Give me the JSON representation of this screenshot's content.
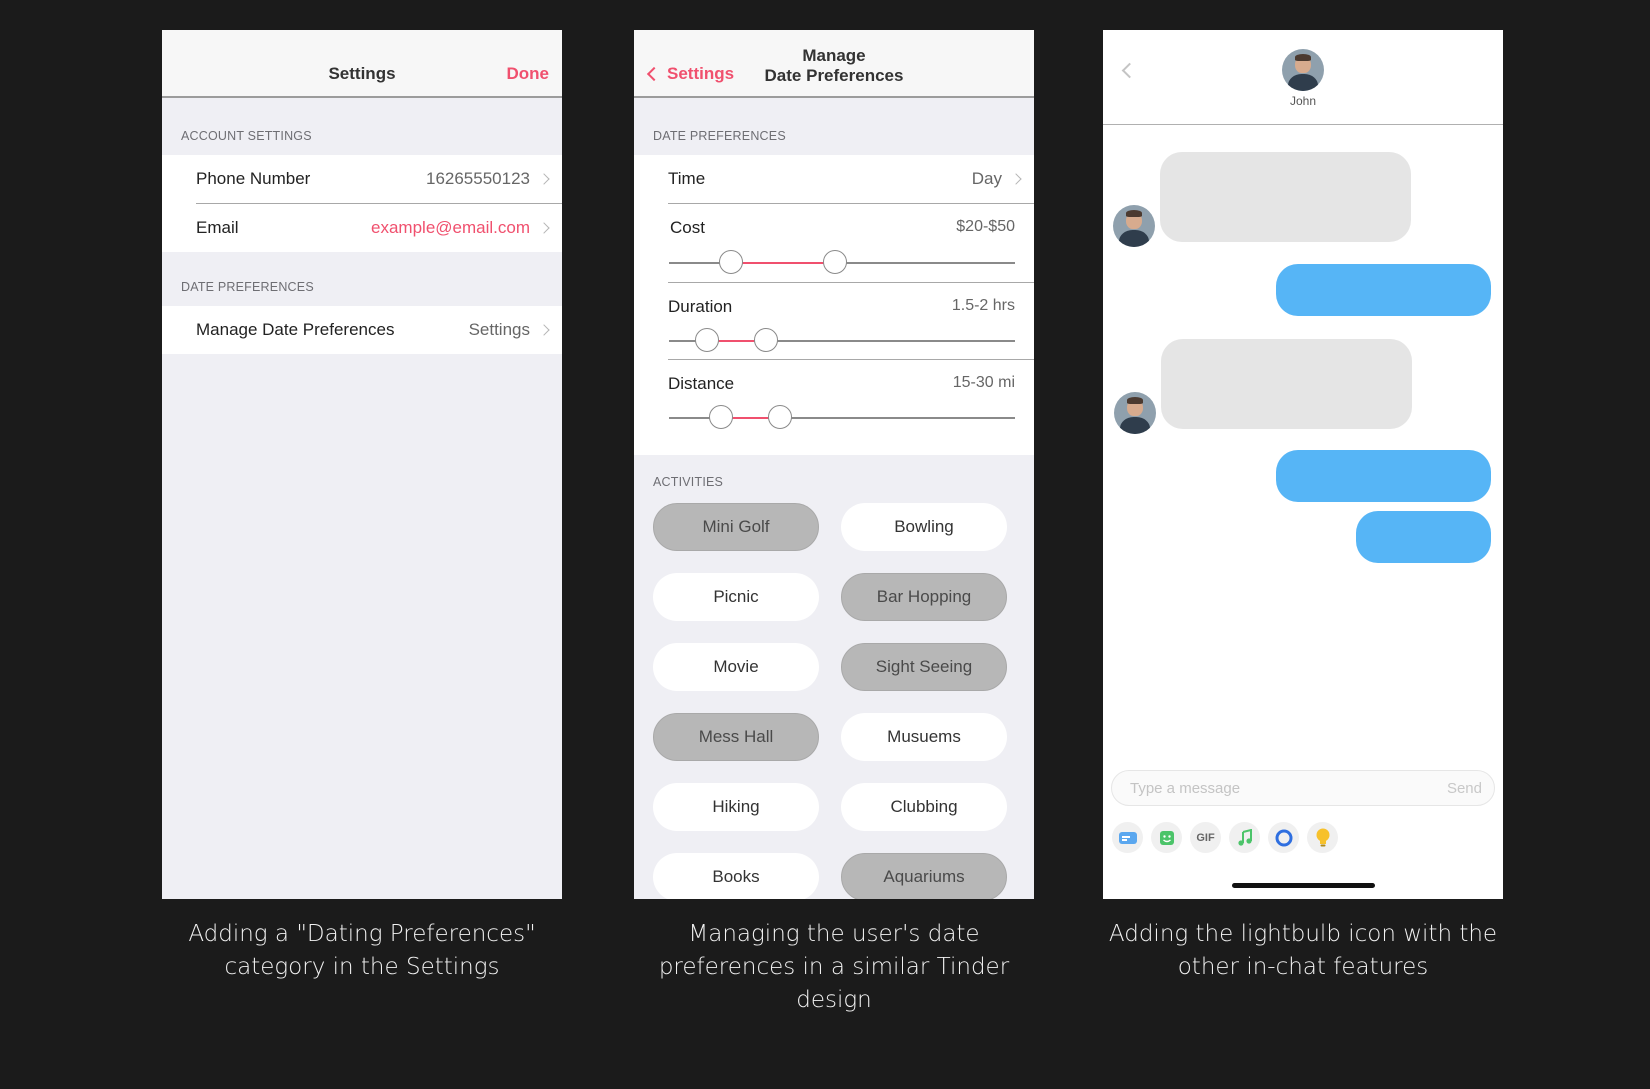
{
  "settings_screen": {
    "title": "Settings",
    "done": "Done",
    "account_header": "ACCOUNT SETTINGS",
    "phone_label": "Phone Number",
    "phone_value": "16265550123",
    "email_label": "Email",
    "email_value": "example@email.com",
    "date_header": "DATE PREFERENCES",
    "manage_label": "Manage Date Preferences",
    "manage_value": "Settings"
  },
  "preferences_screen": {
    "back_label": "Settings",
    "title_line1": "Manage",
    "title_line2": "Date Preferences",
    "section_header": "DATE PREFERENCES",
    "time_label": "Time",
    "time_value": "Day",
    "sliders": {
      "cost": {
        "label": "Cost",
        "value": "$20-$50",
        "low": 0.18,
        "high": 0.48
      },
      "duration": {
        "label": "Duration",
        "value": "1.5-2 hrs",
        "low": 0.11,
        "high": 0.28
      },
      "distance": {
        "label": "Distance",
        "value": "15-30 mi",
        "low": 0.15,
        "high": 0.32
      }
    },
    "activities_header": "ACTIVITIES",
    "activities": [
      {
        "label": "Mini Golf",
        "selected": true
      },
      {
        "label": "Bowling",
        "selected": false
      },
      {
        "label": "Picnic",
        "selected": false
      },
      {
        "label": "Bar Hopping",
        "selected": true
      },
      {
        "label": "Movie",
        "selected": false
      },
      {
        "label": "Sight Seeing",
        "selected": true
      },
      {
        "label": "Mess Hall",
        "selected": true
      },
      {
        "label": "Musuems",
        "selected": false
      },
      {
        "label": "Hiking",
        "selected": false
      },
      {
        "label": "Clubbing",
        "selected": false
      },
      {
        "label": "Books",
        "selected": false
      },
      {
        "label": "Aquariums",
        "selected": true
      }
    ]
  },
  "chat_screen": {
    "contact_name": "John",
    "input_placeholder": "Type a message",
    "send_label": "Send",
    "tools": [
      "card-icon",
      "sticker-icon",
      "gif-icon",
      "music-icon",
      "loop-icon",
      "lightbulb-icon"
    ],
    "gif_text": "GIF"
  },
  "captions": {
    "settings": "Adding a \"Dating Preferences\" category in the Settings",
    "preferences": "Managing the user's date preferences in a similar Tinder design",
    "chat": "Adding the lightbulb icon with the other in-chat features"
  },
  "colors": {
    "accent": "#f0506e",
    "outgoing_bubble": "#56b5f6",
    "incoming_bubble": "#e5e5e5",
    "selected_pill": "#b7b7b7"
  }
}
